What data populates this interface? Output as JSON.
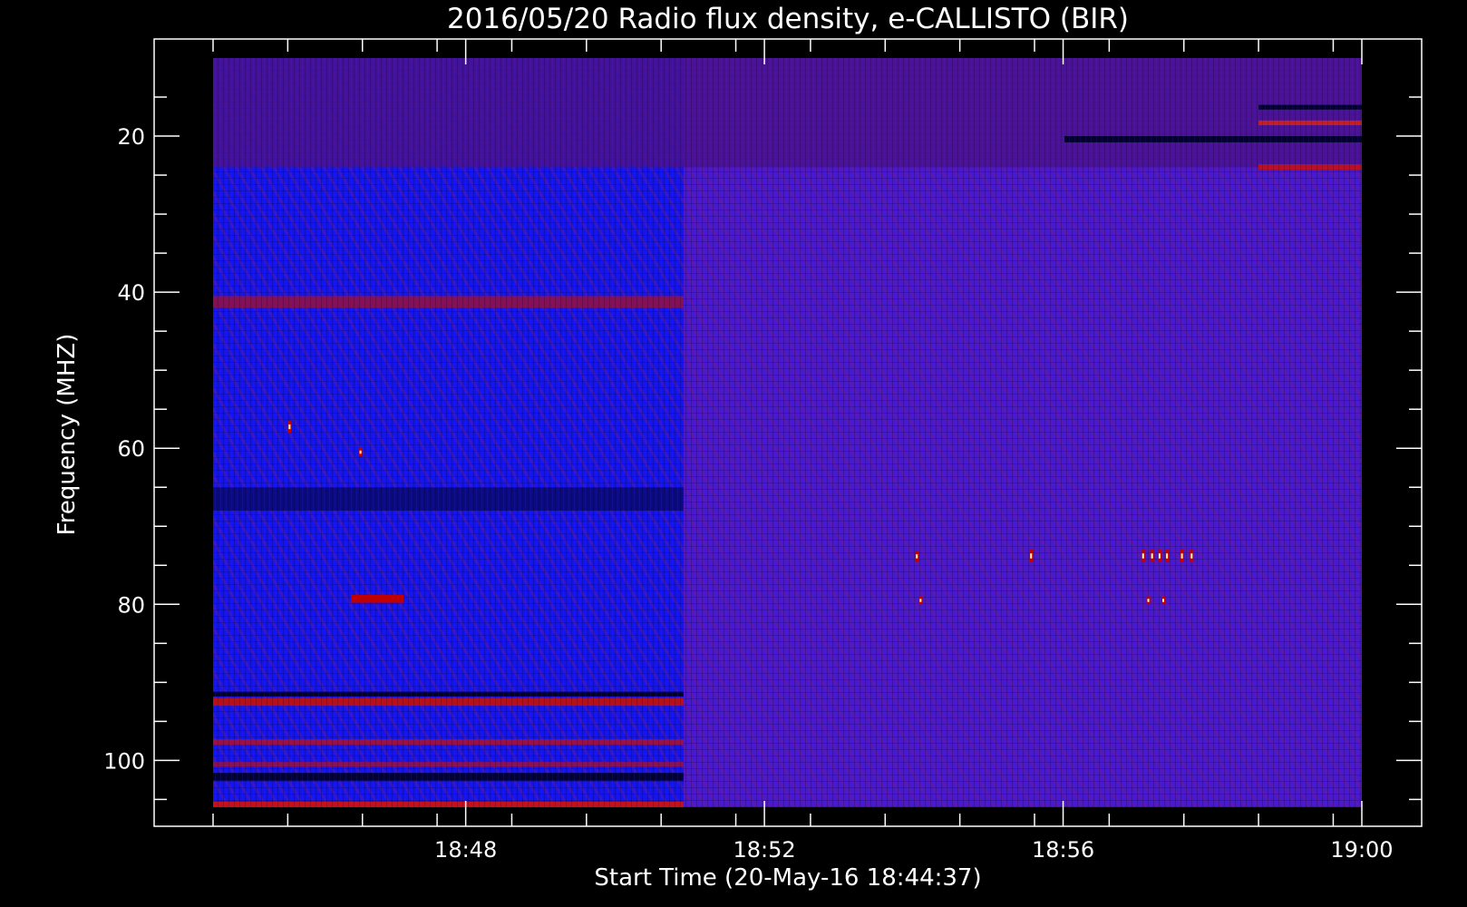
{
  "chart_data": {
    "type": "heatmap",
    "title": "2016/05/20  Radio flux density, e-CALLISTO (BIR)",
    "xlabel": "Start Time (20-May-16 18:44:37)",
    "ylabel": "Frequency (MHZ)",
    "x_tick_labels": [
      "18:48",
      "18:52",
      "18:56",
      "19:00"
    ],
    "x_tick_minutes": [
      3.383,
      7.383,
      11.383,
      15.383
    ],
    "y_ticks": [
      20,
      40,
      60,
      80,
      100
    ],
    "y_tick_labels": [
      "20",
      "40",
      "60",
      "80",
      "100"
    ],
    "ylim": [
      10,
      106
    ],
    "y_inverted": true,
    "data_x_range_minutes": [
      0.0,
      15.383
    ],
    "colors": {
      "background": "#000000",
      "low": "#1010ff",
      "mid": "#5a18c8",
      "high": "#c00000",
      "peak": "#ffffb0",
      "axis": "#ffffff"
    },
    "regime_change_minute": 6.3,
    "bands": [
      {
        "f_low": 10.0,
        "f_high": 24.0,
        "x_from": 0.0,
        "x_to": 15.383,
        "color": "#4a1090",
        "label": "noisy low-frequency band"
      },
      {
        "f_low": 40.5,
        "f_high": 42.0,
        "x_from": 0.0,
        "x_to": 6.3,
        "color": "#8a1050"
      },
      {
        "f_low": 65.0,
        "f_high": 68.0,
        "x_from": 0.0,
        "x_to": 6.3,
        "color": "#0a0a80"
      },
      {
        "f_low": 91.2,
        "f_high": 91.8,
        "x_from": 0.0,
        "x_to": 6.3,
        "color": "#000020"
      },
      {
        "f_low": 92.0,
        "f_high": 93.0,
        "x_from": 0.0,
        "x_to": 6.3,
        "color": "#c01010"
      },
      {
        "f_low": 97.3,
        "f_high": 98.0,
        "x_from": 0.0,
        "x_to": 6.3,
        "color": "#a01040"
      },
      {
        "f_low": 100.2,
        "f_high": 100.8,
        "x_from": 0.0,
        "x_to": 6.3,
        "color": "#901050"
      },
      {
        "f_low": 101.6,
        "f_high": 102.6,
        "x_from": 0.0,
        "x_to": 6.3,
        "color": "#000030"
      },
      {
        "f_low": 105.3,
        "f_high": 106.0,
        "x_from": 0.0,
        "x_to": 6.3,
        "color": "#d01010"
      },
      {
        "f_low": 20.0,
        "f_high": 20.8,
        "x_from": 11.4,
        "x_to": 15.383,
        "color": "#000030"
      },
      {
        "f_low": 18.0,
        "f_high": 18.6,
        "x_from": 14.0,
        "x_to": 15.383,
        "color": "#d02020"
      },
      {
        "f_low": 23.6,
        "f_high": 24.3,
        "x_from": 14.0,
        "x_to": 15.383,
        "color": "#c01020"
      },
      {
        "f_low": 16.0,
        "f_high": 16.6,
        "x_from": 14.0,
        "x_to": 15.383,
        "color": "#000030"
      }
    ],
    "bursts": [
      {
        "minute": 1.0,
        "f_low": 56.5,
        "f_high": 58.0
      },
      {
        "minute": 1.95,
        "f_low": 60.0,
        "f_high": 61.0
      },
      {
        "minute": 1.85,
        "f_low": 78.8,
        "f_high": 79.8,
        "x_to": 2.55
      },
      {
        "minute": 9.4,
        "f_low": 73.2,
        "f_high": 74.5
      },
      {
        "minute": 10.93,
        "f_low": 73.0,
        "f_high": 74.6
      },
      {
        "minute": 12.43,
        "f_low": 73.0,
        "f_high": 74.6
      },
      {
        "minute": 12.55,
        "f_low": 73.0,
        "f_high": 74.6
      },
      {
        "minute": 12.65,
        "f_low": 73.0,
        "f_high": 74.6
      },
      {
        "minute": 12.75,
        "f_low": 73.0,
        "f_high": 74.6
      },
      {
        "minute": 12.95,
        "f_low": 73.0,
        "f_high": 74.6
      },
      {
        "minute": 13.08,
        "f_low": 73.0,
        "f_high": 74.6
      },
      {
        "minute": 9.45,
        "f_low": 79.0,
        "f_high": 80.0
      },
      {
        "minute": 12.5,
        "f_low": 79.0,
        "f_high": 80.0
      },
      {
        "minute": 12.7,
        "f_low": 79.0,
        "f_high": 80.0
      }
    ]
  }
}
